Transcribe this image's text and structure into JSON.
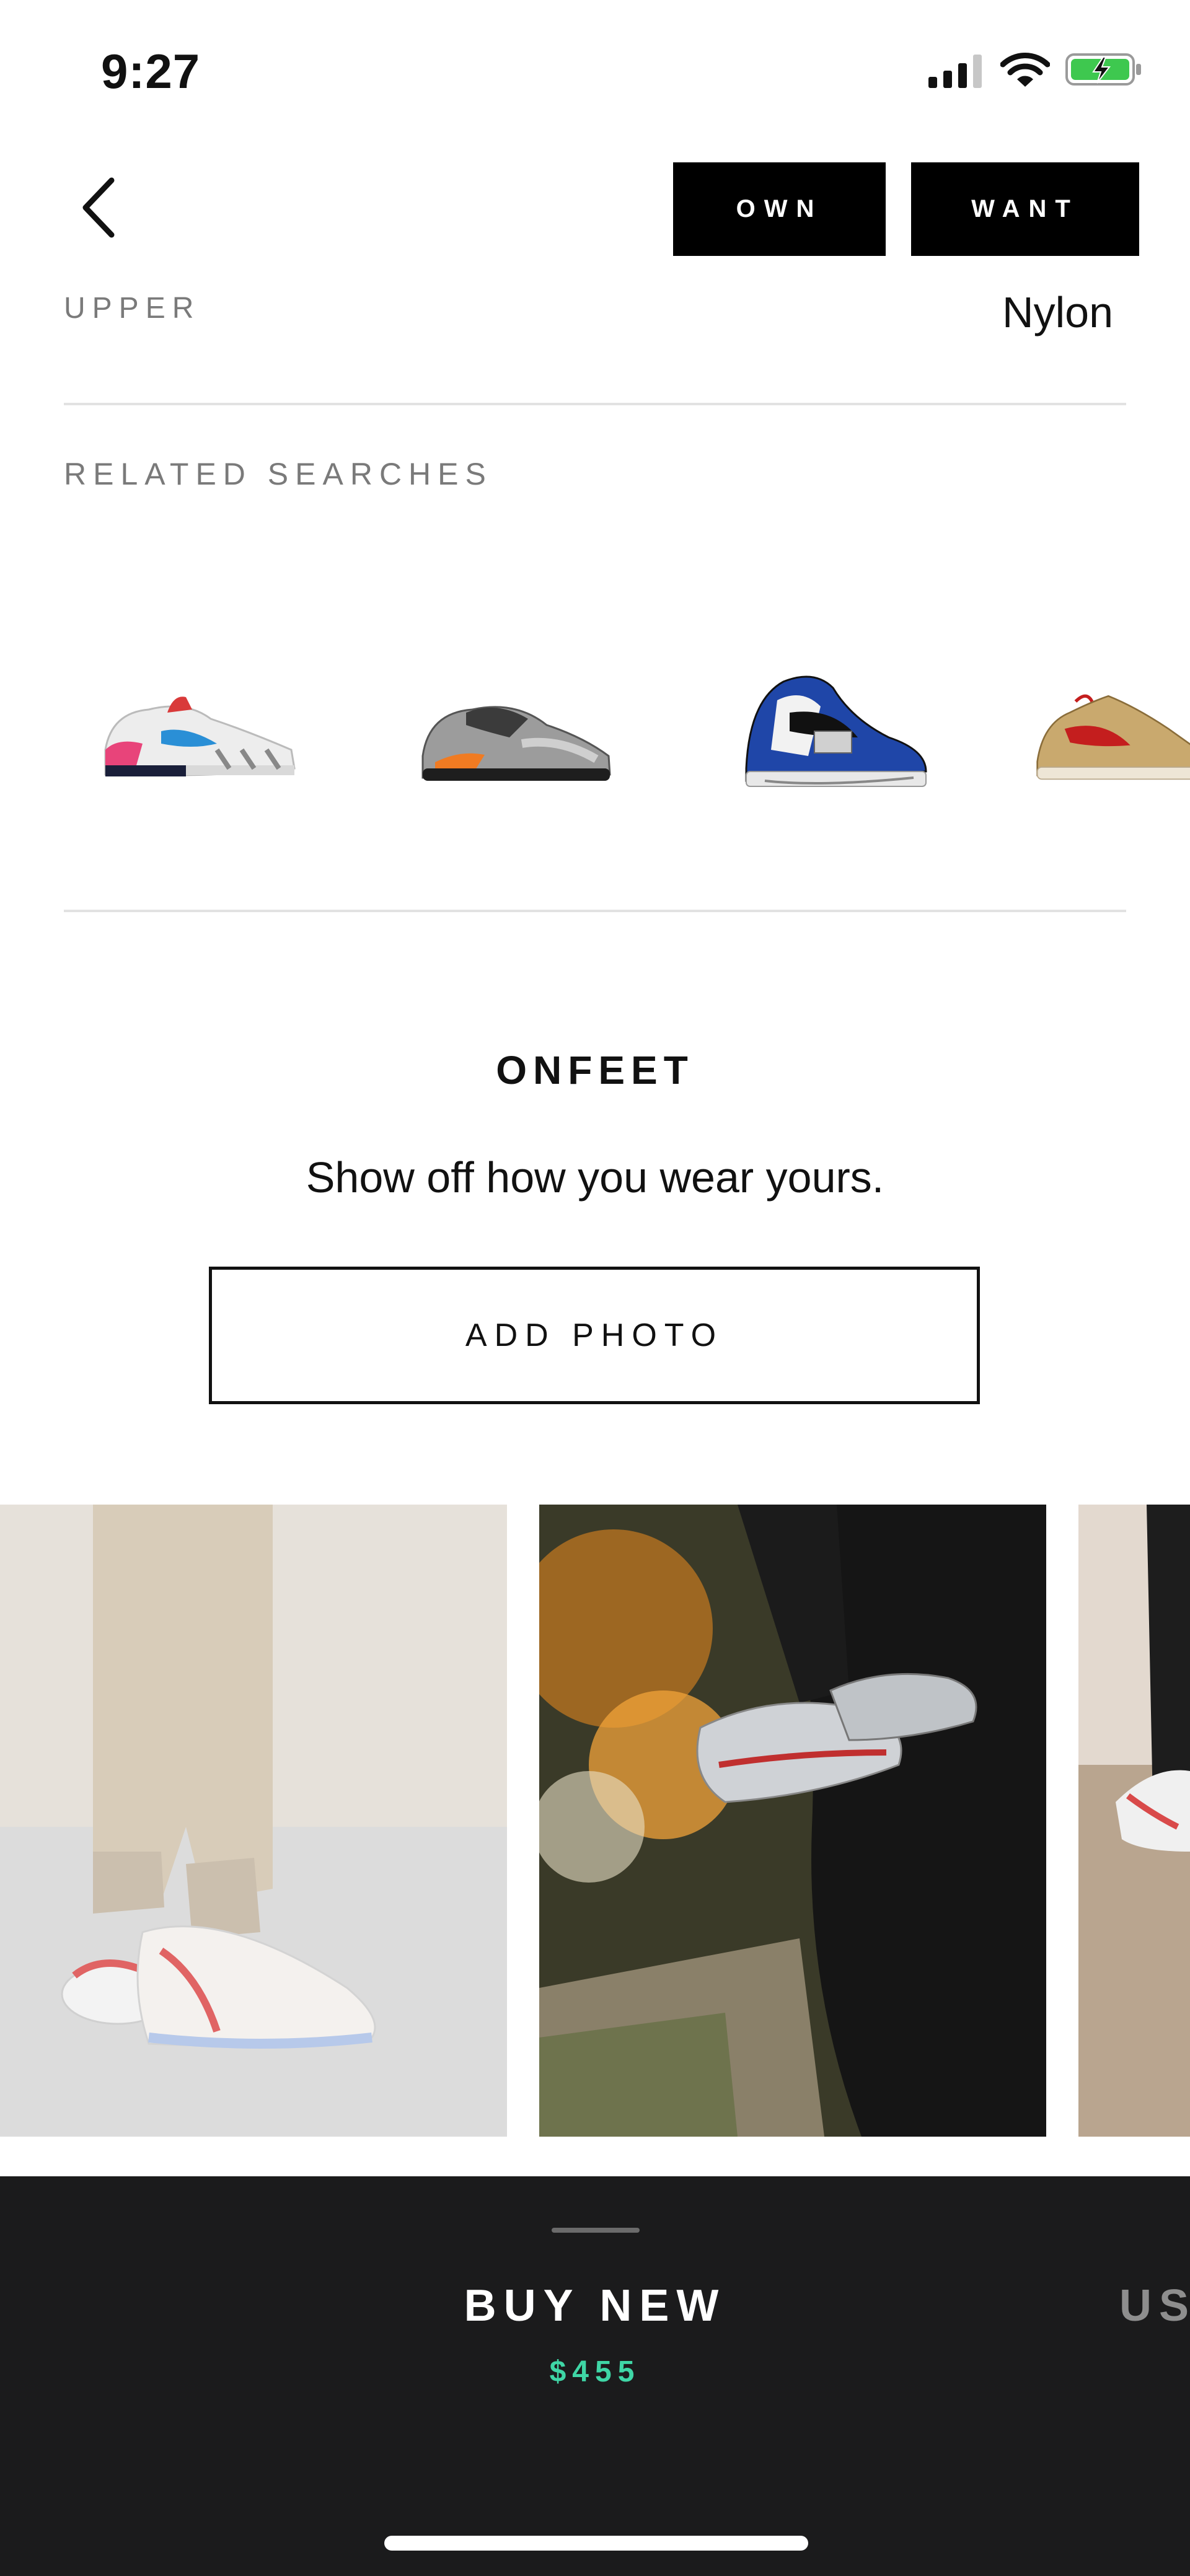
{
  "status_bar": {
    "time": "9:27"
  },
  "nav": {
    "own_label": "OWN",
    "want_label": "WANT"
  },
  "spec": {
    "label": "UPPER",
    "value": "Nylon"
  },
  "related": {
    "title": "RELATED SEARCHES",
    "items": [
      {
        "icon": "sneaker-air-max-1-icon"
      },
      {
        "icon": "sneaker-yeezy-700-icon"
      },
      {
        "icon": "sneaker-jordan-legacy-icon"
      },
      {
        "icon": "sneaker-mars-yard-icon"
      }
    ]
  },
  "onfeet": {
    "title": "ONFEET",
    "subtitle": "Show off how you wear yours.",
    "button_label": "ADD PHOTO"
  },
  "bottom_bar": {
    "buy_new_label": "BUY NEW",
    "buy_new_price": "$455",
    "used_label_partial": "US"
  },
  "colors": {
    "bottom_bar": "#1b1b1c",
    "price_accent": "#3fd6a6",
    "button_black": "#000000"
  }
}
